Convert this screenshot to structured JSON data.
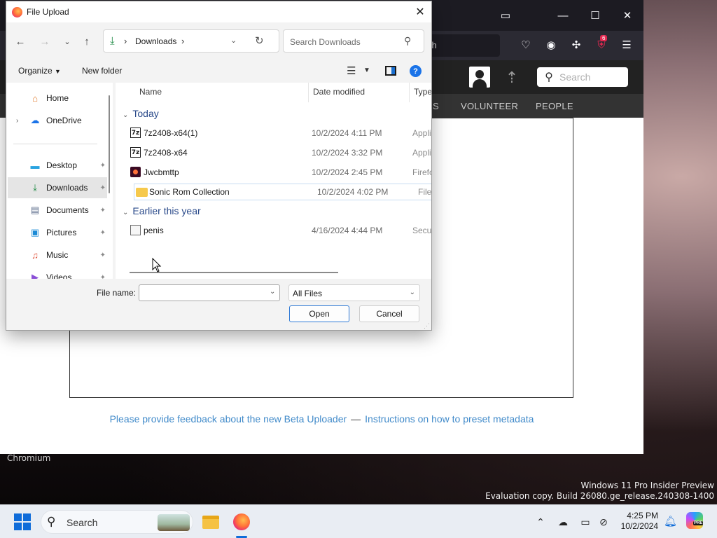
{
  "dialog": {
    "title": "File Upload",
    "breadcrumb": "Downloads",
    "search_placeholder": "Search Downloads",
    "organize_label": "Organize",
    "new_folder_label": "New folder",
    "help_label": "?",
    "nav_items": [
      {
        "label": "Home",
        "icon": "home-icon"
      },
      {
        "label": "OneDrive",
        "icon": "onedrive-icon"
      },
      {
        "label": "Desktop",
        "icon": "desktop-folder-icon"
      },
      {
        "label": "Downloads",
        "icon": "downloads-folder-icon",
        "selected": true
      },
      {
        "label": "Documents",
        "icon": "documents-folder-icon"
      },
      {
        "label": "Pictures",
        "icon": "pictures-folder-icon"
      },
      {
        "label": "Music",
        "icon": "music-folder-icon"
      },
      {
        "label": "Videos",
        "icon": "videos-folder-icon"
      }
    ],
    "columns": {
      "name": "Name",
      "date": "Date modified",
      "type": "Type"
    },
    "groups": [
      {
        "label": "Today",
        "files": [
          {
            "name": "7z2408-x64(1)",
            "date": "10/2/2024 4:11 PM",
            "type": "Application",
            "icon": "7zip-icon"
          },
          {
            "name": "7z2408-x64",
            "date": "10/2/2024 3:32 PM",
            "type": "Application",
            "icon": "7zip-icon"
          },
          {
            "name": "Jwcbmttp",
            "date": "10/2/2024 2:45 PM",
            "type": "Firefox Document",
            "icon": "firefox-document-icon"
          },
          {
            "name": "Sonic Rom Collection",
            "date": "10/2/2024 4:02 PM",
            "type": "File folder",
            "icon": "folder-icon"
          }
        ]
      },
      {
        "label": "Earlier this year",
        "files": [
          {
            "name": "penis",
            "date": "4/16/2024 4:44 PM",
            "type": "Security Certificate",
            "icon": "certificate-icon"
          }
        ]
      }
    ],
    "file_name_label": "File name:",
    "file_name_value": "",
    "file_type_value": "All Files",
    "open_label": "Open",
    "cancel_label": "Cancel"
  },
  "browser": {
    "url_fragment": "ch",
    "toolbar_badge": "6",
    "nav_items": [
      "S",
      "VOLUNTEER",
      "PEOPLE"
    ],
    "search_placeholder": "Search",
    "feedback_link": "Please provide feedback about the new Beta Uploader",
    "feedback_separator": "—",
    "instructions_link": "Instructions on how to preset metadata"
  },
  "desktop": {
    "window_label": "Chromium",
    "watermark_line1": "Windows 11 Pro Insider Preview",
    "watermark_line2": "Evaluation copy. Build 26080.ge_release.240308-1400"
  },
  "taskbar": {
    "search_label": "Search",
    "time": "4:25 PM",
    "date": "10/2/2024",
    "copilot_badge": "PRE"
  },
  "colors": {
    "accent": "#0f6cd9",
    "link": "#428bca",
    "group_heading": "#2a4a8a",
    "dialog_background": "#f3f3f3"
  }
}
